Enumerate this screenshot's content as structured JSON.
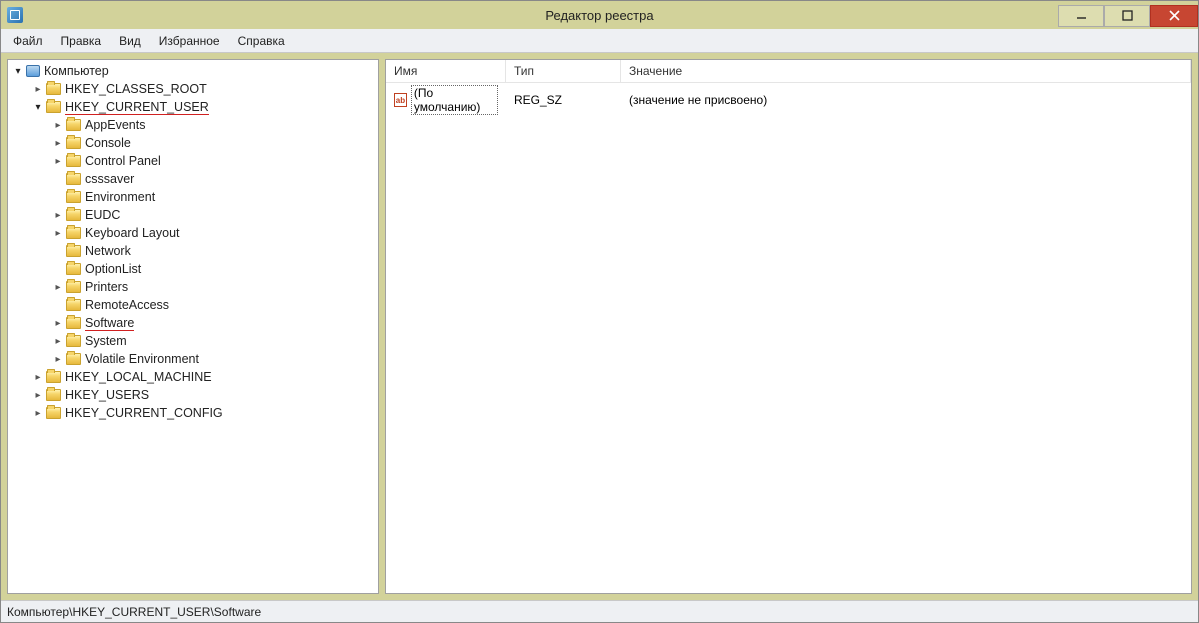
{
  "window": {
    "title": "Редактор реестра"
  },
  "menu": {
    "items": [
      "Файл",
      "Правка",
      "Вид",
      "Избранное",
      "Справка"
    ]
  },
  "tree": {
    "root": {
      "label": "Компьютер",
      "icon": "computer",
      "expanded": true,
      "children": [
        {
          "label": "HKEY_CLASSES_ROOT",
          "expandable": true
        },
        {
          "label": "HKEY_CURRENT_USER",
          "expandable": true,
          "expanded": true,
          "underline": true,
          "children": [
            {
              "label": "AppEvents",
              "expandable": true
            },
            {
              "label": "Console",
              "expandable": true
            },
            {
              "label": "Control Panel",
              "expandable": true
            },
            {
              "label": "csssaver",
              "expandable": false
            },
            {
              "label": "Environment",
              "expandable": false
            },
            {
              "label": "EUDC",
              "expandable": true
            },
            {
              "label": "Keyboard Layout",
              "expandable": true
            },
            {
              "label": "Network",
              "expandable": false
            },
            {
              "label": "OptionList",
              "expandable": false
            },
            {
              "label": "Printers",
              "expandable": true
            },
            {
              "label": "RemoteAccess",
              "expandable": false
            },
            {
              "label": "Software",
              "expandable": true,
              "underline": true
            },
            {
              "label": "System",
              "expandable": true
            },
            {
              "label": "Volatile Environment",
              "expandable": true
            }
          ]
        },
        {
          "label": "HKEY_LOCAL_MACHINE",
          "expandable": true
        },
        {
          "label": "HKEY_USERS",
          "expandable": true
        },
        {
          "label": "HKEY_CURRENT_CONFIG",
          "expandable": true
        }
      ]
    }
  },
  "list": {
    "columns": {
      "name": "Имя",
      "type": "Тип",
      "value": "Значение"
    },
    "rows": [
      {
        "name": "(По умолчанию)",
        "type": "REG_SZ",
        "value": "(значение не присвоено)",
        "selected": true
      }
    ],
    "string_icon_label": "ab"
  },
  "statusbar": {
    "path": "Компьютер\\HKEY_CURRENT_USER\\Software"
  }
}
